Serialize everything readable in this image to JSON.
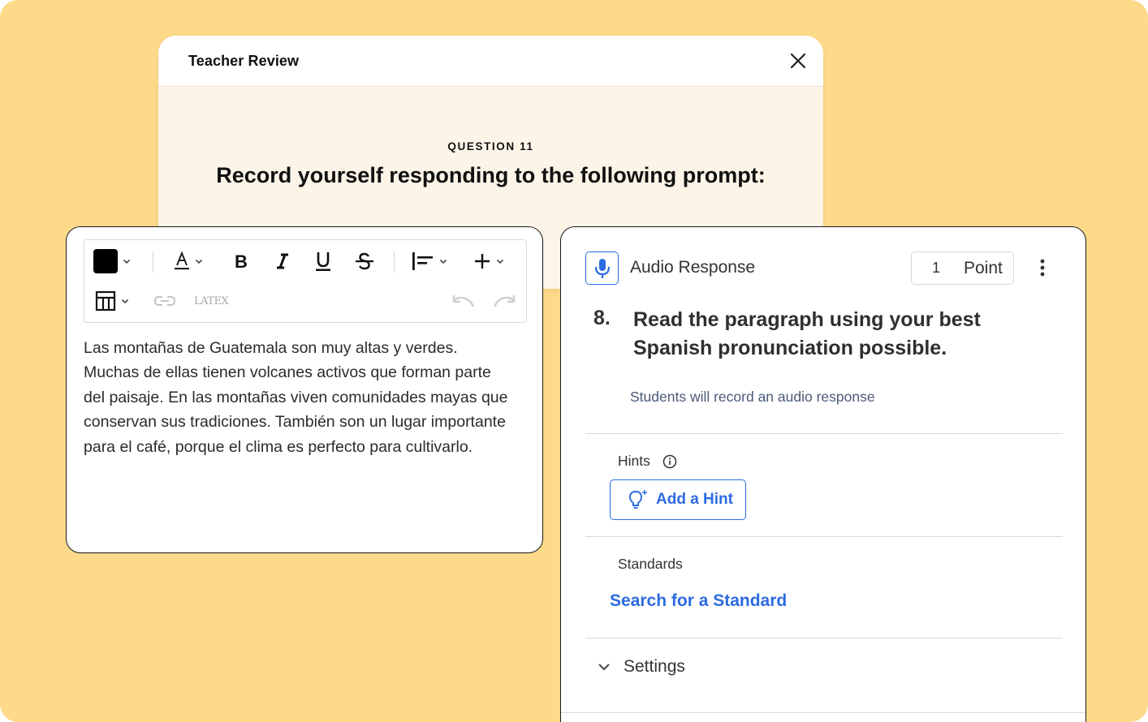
{
  "review": {
    "title": "Teacher Review",
    "question_label": "QUESTION 11",
    "prompt": "Record yourself responding to the following prompt:"
  },
  "editor": {
    "toolbar": {
      "text_color": "#000000",
      "latex_label": "LATEX"
    },
    "text": "Las montañas de Guatemala son muy altas y verdes. Muchas de ellas tienen volcanes activos que forman parte del paisaje. En las montañas viven comunidades mayas que conservan sus tradiciones. También son un lugar importante para el café, porque el clima es perfecto para cultivarlo."
  },
  "audio": {
    "title": "Audio Response",
    "points_value": "1",
    "points_label": "Point",
    "question_number": "8.",
    "question_text": "Read the paragraph using your best Spanish pronunciation possible.",
    "subtext": "Students will record an audio response",
    "hints_label": "Hints",
    "add_hint_label": "Add a Hint",
    "standards_label": "Standards",
    "standard_link": "Search for a Standard",
    "settings_label": "Settings"
  },
  "colors": {
    "background": "#FDD98A",
    "accent": "#2D6BE0",
    "review_body": "#FDF4E8"
  }
}
